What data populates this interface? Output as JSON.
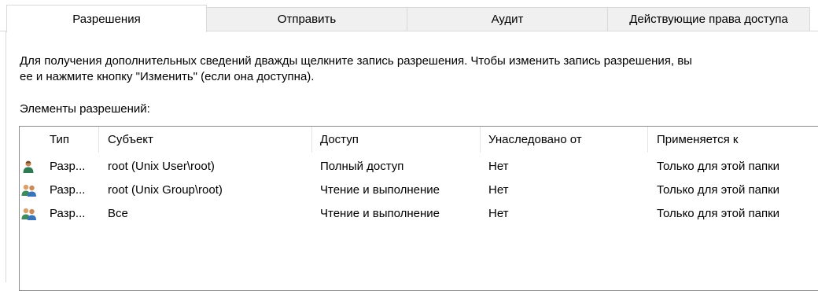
{
  "tabs": [
    {
      "label": "Разрешения",
      "active": true
    },
    {
      "label": "Отправить",
      "active": false
    },
    {
      "label": "Аудит",
      "active": false
    },
    {
      "label": "Действующие права доступа",
      "active": false
    }
  ],
  "description": {
    "line1": "Для получения дополнительных сведений дважды щелкните запись разрешения. Чтобы изменить запись разрешения, вы",
    "line2": "ее и нажмите кнопку \"Изменить\" (если она доступна)."
  },
  "elements_label": "Элементы разрешений:",
  "table": {
    "columns": [
      "Тип",
      "Субъект",
      "Доступ",
      "Унаследовано от",
      "Применяется к"
    ],
    "rows": [
      {
        "icon": "single-user-icon",
        "type": "Разр...",
        "subject": "root (Unix User\\root)",
        "access": "Полный доступ",
        "inherited": "Нет",
        "applies": "Только для этой папки"
      },
      {
        "icon": "group-users-icon",
        "type": "Разр...",
        "subject": "root (Unix Group\\root)",
        "access": "Чтение и выполнение",
        "inherited": "Нет",
        "applies": "Только для этой папки"
      },
      {
        "icon": "group-users-icon",
        "type": "Разр...",
        "subject": "Все",
        "access": "Чтение и выполнение",
        "inherited": "Нет",
        "applies": "Только для этой папки"
      }
    ]
  },
  "colors": {
    "tab_inactive_bg": "#f0f0f0",
    "border": "#d9d9d9",
    "list_border": "#8a8a8a"
  }
}
